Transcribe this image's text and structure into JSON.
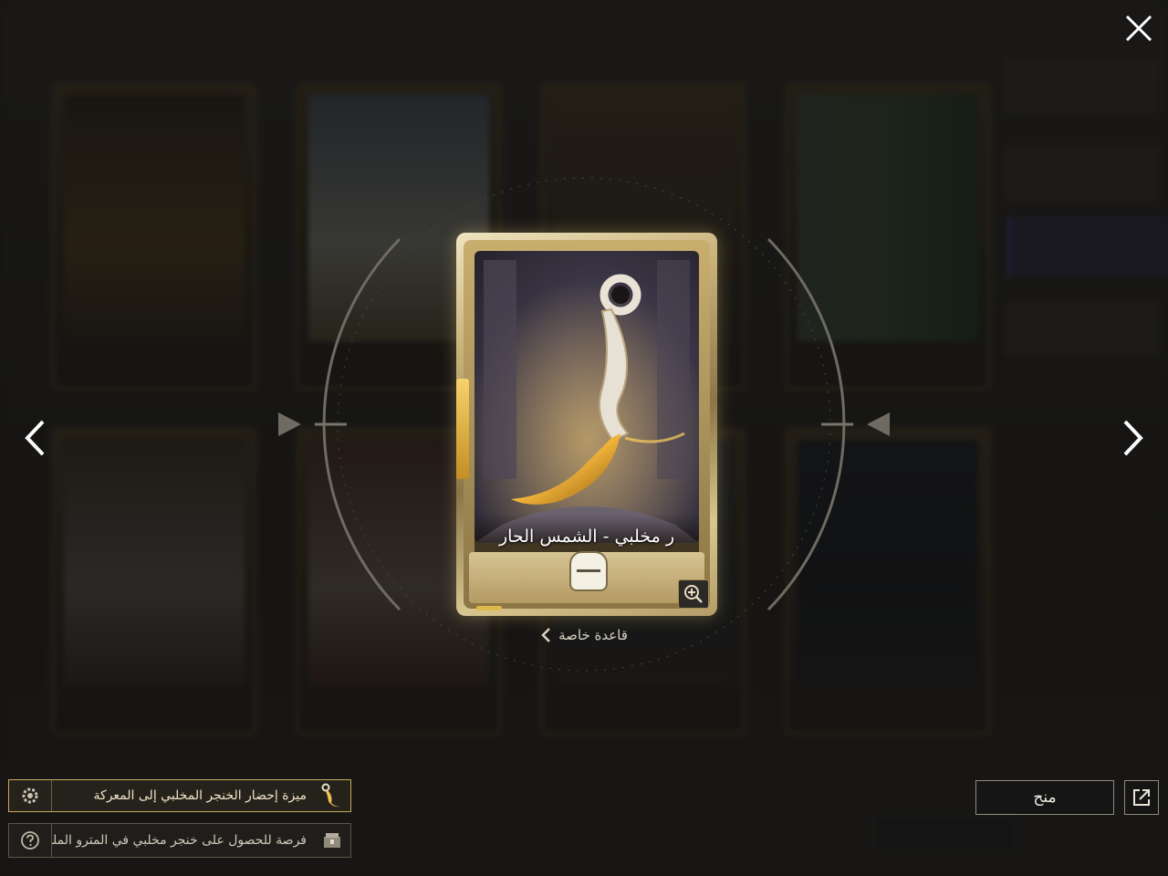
{
  "modal": {
    "close_icon": "close-icon",
    "prev_icon": "chevron-left-icon",
    "next_icon": "chevron-right-icon"
  },
  "card": {
    "name": "ر مخلبي - الشمس الحار",
    "zoom_icon": "zoom-in-icon",
    "accent": "#c9a959"
  },
  "special_rule": {
    "label": "قاعدة خاصة",
    "icon": "chevron-left-icon"
  },
  "feature_bar": {
    "text": "ميزة إحضار الخنجر المخلبي إلى المعركة",
    "left_icon": "gear-icon",
    "right_icon": "dagger-icon"
  },
  "chance_bar": {
    "text": "فرصة للحصول على خنجر مخلبي في المترو الملكي",
    "left_icon": "help-icon",
    "right_icon": "chest-icon"
  },
  "actions": {
    "gift_label": "منح",
    "share_icon": "share-icon"
  }
}
